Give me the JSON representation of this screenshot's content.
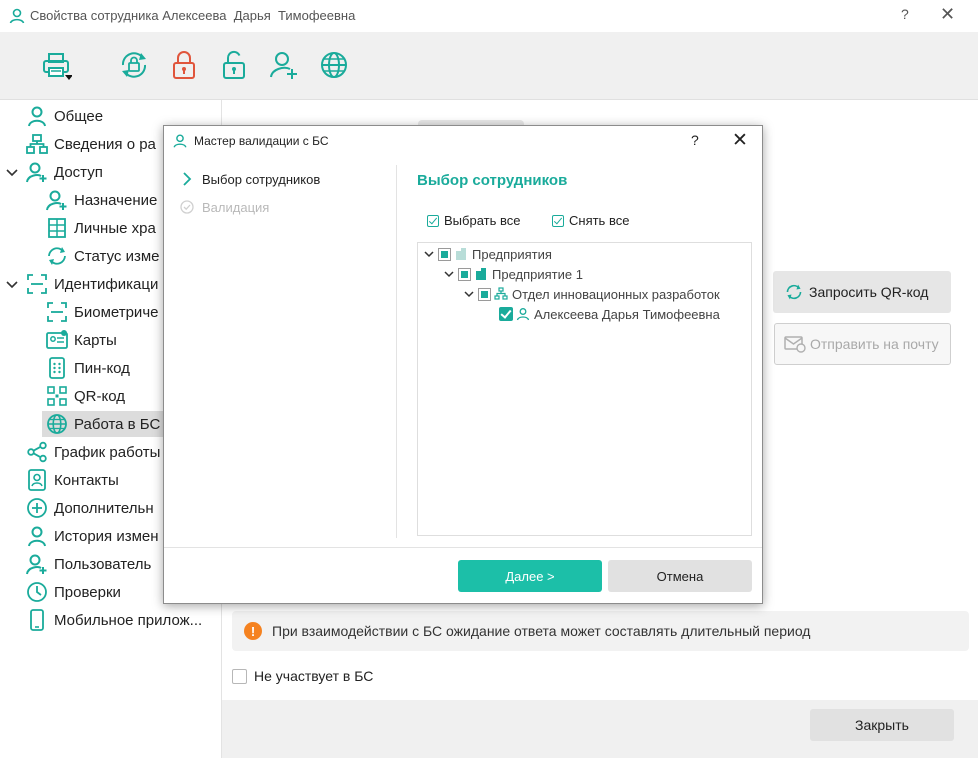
{
  "window": {
    "title": "Свойства сотрудника Алексеева  Дарья  Тимофеевна",
    "help": "?",
    "close": "✕"
  },
  "colors": {
    "accent": "#1aab9b",
    "primary_button": "#1cbfa8",
    "warning": "#f58220",
    "lock_red": "#e0553c"
  },
  "toolbar": {
    "icons": [
      "printer-icon",
      "sync-lock-icon",
      "lock-icon",
      "unlock-icon",
      "user-add-icon",
      "globe-icon"
    ]
  },
  "sidebar": {
    "items": [
      {
        "label": "Общее",
        "icon": "user-icon"
      },
      {
        "label": "Сведения о ра",
        "icon": "org-structure-icon"
      },
      {
        "label": "Доступ",
        "icon": "user-key-icon"
      },
      {
        "label": "Назначение",
        "icon": "user-add-icon"
      },
      {
        "label": "Личные хра",
        "icon": "locker-grid-icon"
      },
      {
        "label": "Статус изме",
        "icon": "refresh-icon"
      },
      {
        "label": "Идентификаци",
        "icon": "scan-frame-icon"
      },
      {
        "label": "Биометриче",
        "icon": "face-scan-icon"
      },
      {
        "label": "Карты",
        "icon": "id-card-icon"
      },
      {
        "label": "Пин-код",
        "icon": "keypad-icon"
      },
      {
        "label": "QR-код",
        "icon": "qr-code-icon"
      },
      {
        "label": "Работа в БС",
        "icon": "globe-icon"
      },
      {
        "label": "График работы",
        "icon": "share-icon"
      },
      {
        "label": "Контакты",
        "icon": "contact-book-icon"
      },
      {
        "label": "Дополнительн",
        "icon": "plus-circle-icon"
      },
      {
        "label": "История измен",
        "icon": "user-history-icon"
      },
      {
        "label": "Пользователь",
        "icon": "user-plus-icon"
      },
      {
        "label": "Проверки",
        "icon": "clock-icon"
      },
      {
        "label": "Мобильное прилож...",
        "icon": "phone-icon"
      }
    ]
  },
  "main": {
    "qr_button": "Запросить QR-код",
    "mail_button": "Отправить на почту",
    "info_text": "При взаимодействии с БС ожидание ответа может составлять длительный период",
    "not_participate": "Не участвует в БС",
    "close_button": "Закрыть"
  },
  "dialog": {
    "title": "Мастер валидации с БС",
    "help": "?",
    "close": "✕",
    "steps": [
      {
        "label": "Выбор сотрудников",
        "state": "current"
      },
      {
        "label": "Валидация",
        "state": "pending"
      }
    ],
    "section_title": "Выбор сотрудников",
    "select_all": "Выбрать все",
    "deselect_all": "Снять все",
    "tree": {
      "root": "Предприятия",
      "company": "Предприятие 1",
      "department": "Отдел инновационных разработок",
      "employee": "Алексеева  Дарья  Тимофеевна"
    },
    "next_button": "Далее >",
    "cancel_button": "Отмена"
  }
}
